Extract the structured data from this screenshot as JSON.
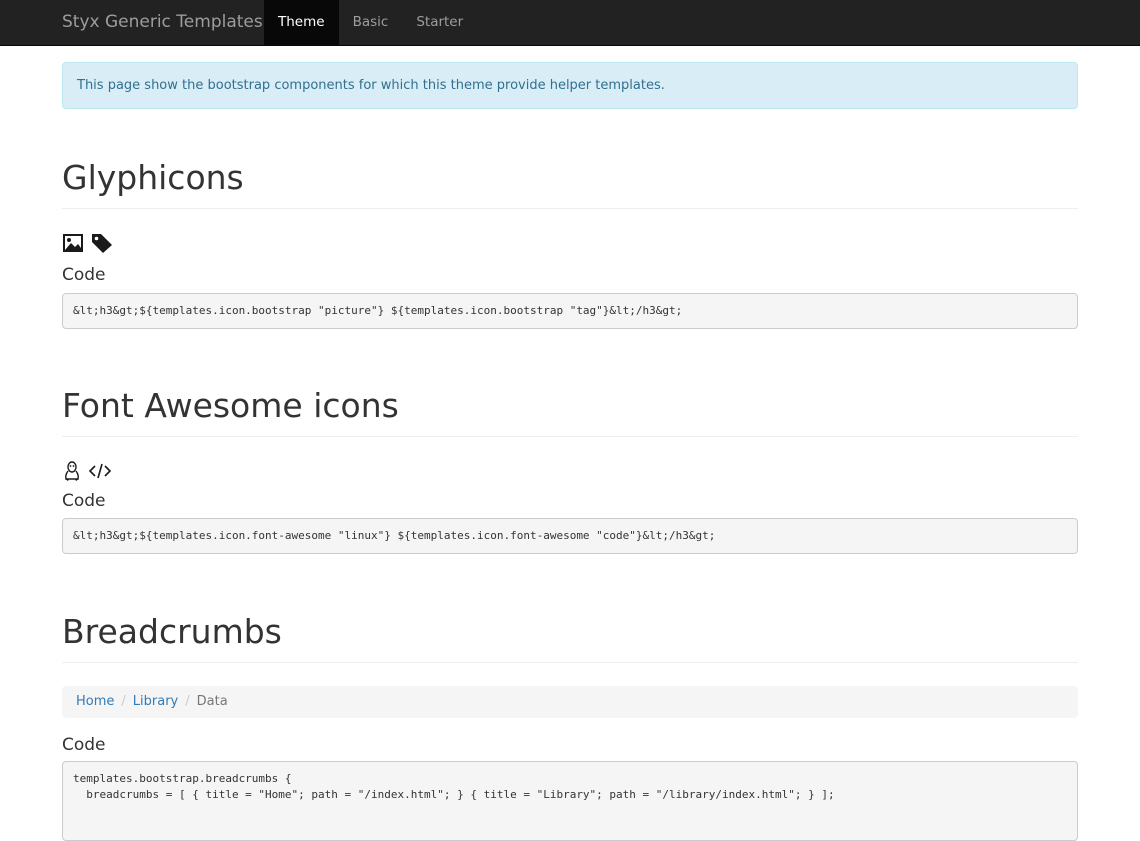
{
  "navbar": {
    "brand": "Styx Generic Templates",
    "items": [
      {
        "label": "Theme",
        "active": true
      },
      {
        "label": "Basic",
        "active": false
      },
      {
        "label": "Starter",
        "active": false
      }
    ]
  },
  "alert": {
    "text": "This page show the bootstrap components for which this theme provide helper templates."
  },
  "sections": {
    "glyphicons": {
      "title": "Glyphicons",
      "icons": [
        "picture-icon",
        "tag-icon"
      ],
      "code_label": "Code",
      "code": "&lt;h3&gt;${templates.icon.bootstrap \"picture\"} ${templates.icon.bootstrap \"tag\"}&lt;/h3&gt;"
    },
    "font_awesome": {
      "title": "Font Awesome icons",
      "icons": [
        "linux-icon",
        "code-icon"
      ],
      "code_label": "Code",
      "code": "&lt;h3&gt;${templates.icon.font-awesome \"linux\"} ${templates.icon.font-awesome \"code\"}&lt;/h3&gt;"
    },
    "breadcrumbs": {
      "title": "Breadcrumbs",
      "crumbs": [
        {
          "label": "Home",
          "link": true
        },
        {
          "label": "Library",
          "link": true
        },
        {
          "label": "Data",
          "link": false
        }
      ],
      "separator": "/",
      "code_label": "Code",
      "code_lines": [
        "templates.bootstrap.breadcrumbs {",
        "  breadcrumbs = [ { title = \"Home\"; path = \"/index.html\"; } { title = \"Library\"; path = \"/library/index.html\"; } ];"
      ]
    }
  }
}
